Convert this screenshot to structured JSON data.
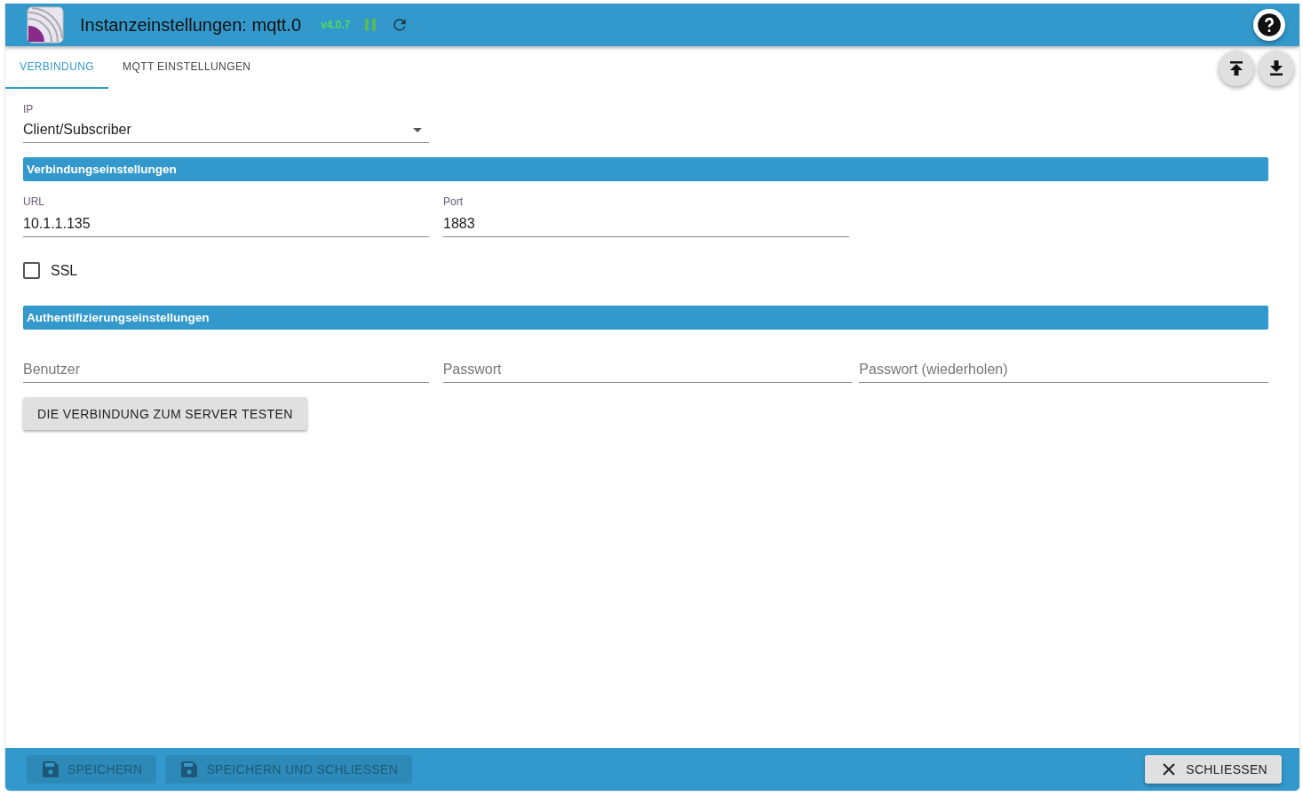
{
  "header": {
    "title": "Instanzeinstellungen: mqtt.0",
    "version": "v4.0.7"
  },
  "tabs": [
    {
      "label": "VERBINDUNG",
      "selected": true
    },
    {
      "label": "MQTT EINSTELLUNGEN",
      "selected": false
    }
  ],
  "ip_select": {
    "label": "IP",
    "value": "Client/Subscriber"
  },
  "sections": [
    {
      "title": "Verbindungseinstellungen",
      "fields": [
        {
          "kind": "text",
          "label": "URL",
          "value": "10.1.1.135"
        },
        {
          "kind": "text",
          "label": "Port",
          "value": "1883"
        }
      ],
      "checkbox": {
        "label": "SSL",
        "checked": false
      }
    },
    {
      "title": "Authentifizierungseinstellungen",
      "fields": [
        {
          "kind": "text",
          "placeholder": "Benutzer"
        },
        {
          "kind": "password",
          "placeholder": "Passwort"
        },
        {
          "kind": "password",
          "placeholder": "Passwort (wiederholen)"
        }
      ],
      "button": "DIE VERBINDUNG ZUM SERVER TESTEN"
    }
  ],
  "footer": {
    "buttons": [
      {
        "label": "SPEICHERN",
        "disabled": true
      },
      {
        "label": "SPEICHERN UND SCHLIESSEN",
        "disabled": true
      }
    ],
    "close": "SCHLIESSEN"
  }
}
